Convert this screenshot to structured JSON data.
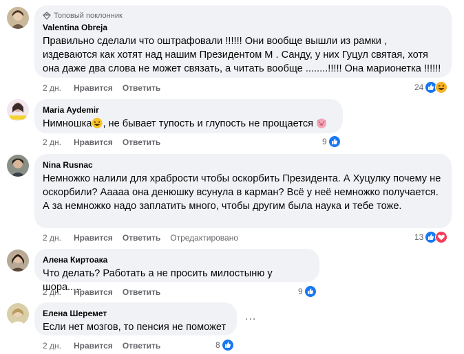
{
  "comments": [
    {
      "badge": "Топовый поклонник",
      "author": "Valentina Obreja",
      "text": "Правильно сделали что оштрафовали !!!!!! Они вообще вышли из рамки , издеваются как хотят над нашим Президентом М . Санду, у них Гуцул святая, хотя она даже два слова не может связать, а читать вообще ........!!!!! Она марионетка !!!!!!",
      "time": "2 дн.",
      "like": "Нравится",
      "reply": "Ответить",
      "reactions_count": "24",
      "reaction_icons": [
        "like-icon",
        "haha-icon"
      ]
    },
    {
      "author": "Maria Aydemir",
      "text_before": "Нимношка",
      "text_after": ", не бывает тупость и глупость не прощается",
      "time": "2 дн.",
      "like": "Нравится",
      "reply": "Ответить",
      "reactions_count": "9",
      "reaction_icons": [
        "like-icon"
      ]
    },
    {
      "author": "Nina Rusnac",
      "text": "Немножко налили для храбрости чтобы оскорбить Президента. А Хуцулку почему не оскорбили? Ааааа она денюшку всунула в карман? Всё у неё немножко получается. А за немножко надо заплатить много, чтобы другим была наука и тебе тоже.",
      "time": "2 дн.",
      "like": "Нравится",
      "reply": "Ответить",
      "edited": "Отредактировано",
      "reactions_count": "13",
      "reaction_icons": [
        "like-icon",
        "love-icon"
      ]
    },
    {
      "author": "Алена Киртоака",
      "text": "Что делать? Работать а не просить милостыню у шора.....",
      "time": "2 дн.",
      "like": "Нравится",
      "reply": "Ответить",
      "reactions_count": "9",
      "reaction_icons": [
        "like-icon"
      ]
    },
    {
      "author": "Елена Шеремет",
      "text": "Если нет мозгов, то пенсия не поможет",
      "time": "2 дн.",
      "like": "Нравится",
      "reply": "Ответить",
      "reactions_count": "8",
      "reaction_icons": [
        "like-icon"
      ],
      "more": "..."
    }
  ],
  "colors": {
    "bubble": "#f0f2f5",
    "secondary_text": "#65676b",
    "like_blue": "#1877f2",
    "love_red": "#f33e58",
    "haha_yellow": "#f7b125"
  }
}
